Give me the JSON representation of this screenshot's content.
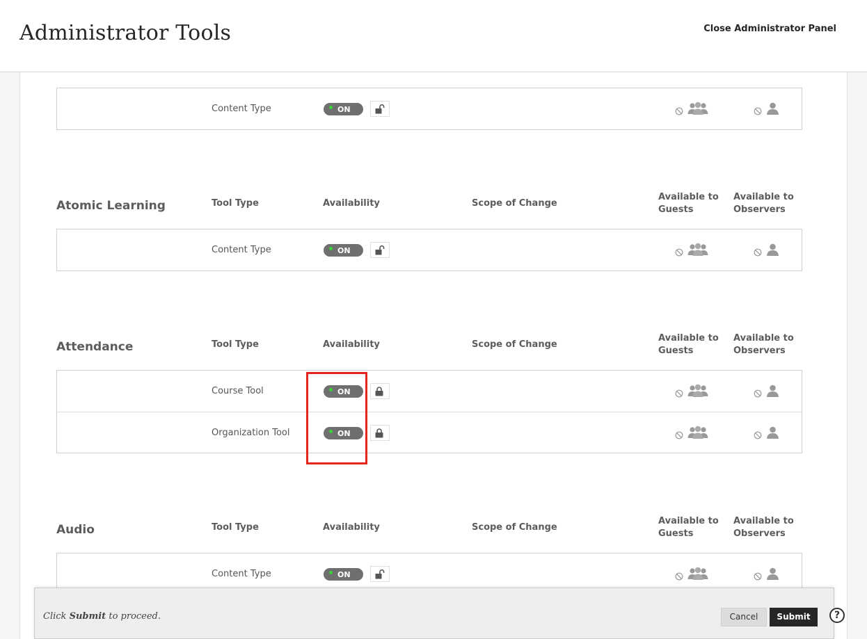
{
  "header": {
    "title": "Administrator Tools",
    "close_label": "Close Administrator Panel"
  },
  "columns": {
    "tool_type": "Tool Type",
    "availability": "Availability",
    "scope": "Scope of Change",
    "guests": "Available to Guests",
    "observers": "Available to Observers"
  },
  "sections": [
    {
      "title": "",
      "rows": [
        {
          "tool_type": "Content Type",
          "availability": "ON",
          "locked": false
        }
      ]
    },
    {
      "title": "Atomic Learning",
      "rows": [
        {
          "tool_type": "Content Type",
          "availability": "ON",
          "locked": false
        }
      ]
    },
    {
      "title": "Attendance",
      "rows": [
        {
          "tool_type": "Course Tool",
          "availability": "ON",
          "locked": true
        },
        {
          "tool_type": "Organization Tool",
          "availability": "ON",
          "locked": true
        }
      ]
    },
    {
      "title": "Audio",
      "rows": [
        {
          "tool_type": "Content Type",
          "availability": "ON",
          "locked": false
        }
      ]
    }
  ],
  "footer": {
    "message_prefix": "Click",
    "message_bold": "Submit",
    "message_suffix": "to proceed.",
    "cancel_label": "Cancel",
    "submit_label": "Submit"
  },
  "help": {
    "label": "?"
  },
  "colors": {
    "toggle_on": "#6f6f6f",
    "status_dot": "#3ad23a",
    "highlight": "#e4261c",
    "submit": "#262626"
  },
  "icons": [
    "unlock-icon",
    "lock-icon",
    "not-allowed-icon",
    "group-icon",
    "user-icon",
    "help-icon"
  ]
}
